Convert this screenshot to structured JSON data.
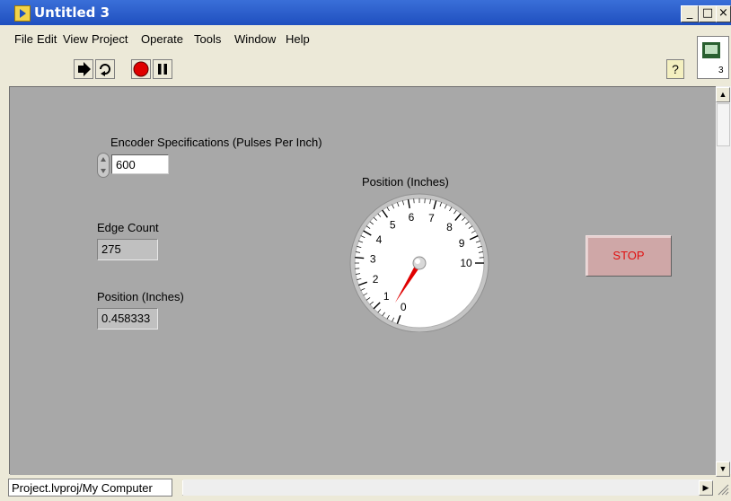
{
  "window": {
    "title": "Untitled 3",
    "min": "_",
    "max": "□",
    "close": "×"
  },
  "menu": [
    "File",
    "Edit",
    "View",
    "Project",
    "Operate",
    "Tools",
    "Window",
    "Help"
  ],
  "toolbar": {
    "help": "?"
  },
  "controls": {
    "encoder_label": "Encoder Specifications (Pulses Per Inch)",
    "encoder_value": "600",
    "edge_label": "Edge Count",
    "edge_value": "275",
    "pos_label": "Position (Inches)",
    "pos_value": "0.458333",
    "gauge_label": "Position (Inches)",
    "stop": "STOP"
  },
  "gauge": {
    "ticks": [
      "0",
      "1",
      "2",
      "3",
      "4",
      "5",
      "6",
      "7",
      "8",
      "9",
      "10"
    ],
    "min": 0,
    "max": 10,
    "value": 0.458333
  },
  "status": {
    "path": "Project.lvproj/My Computer"
  },
  "right_icon": {
    "badge": "3"
  },
  "colors": {
    "panel": "#a8a8a8",
    "needle": "#e00000",
    "stop_text": "#e01010"
  }
}
